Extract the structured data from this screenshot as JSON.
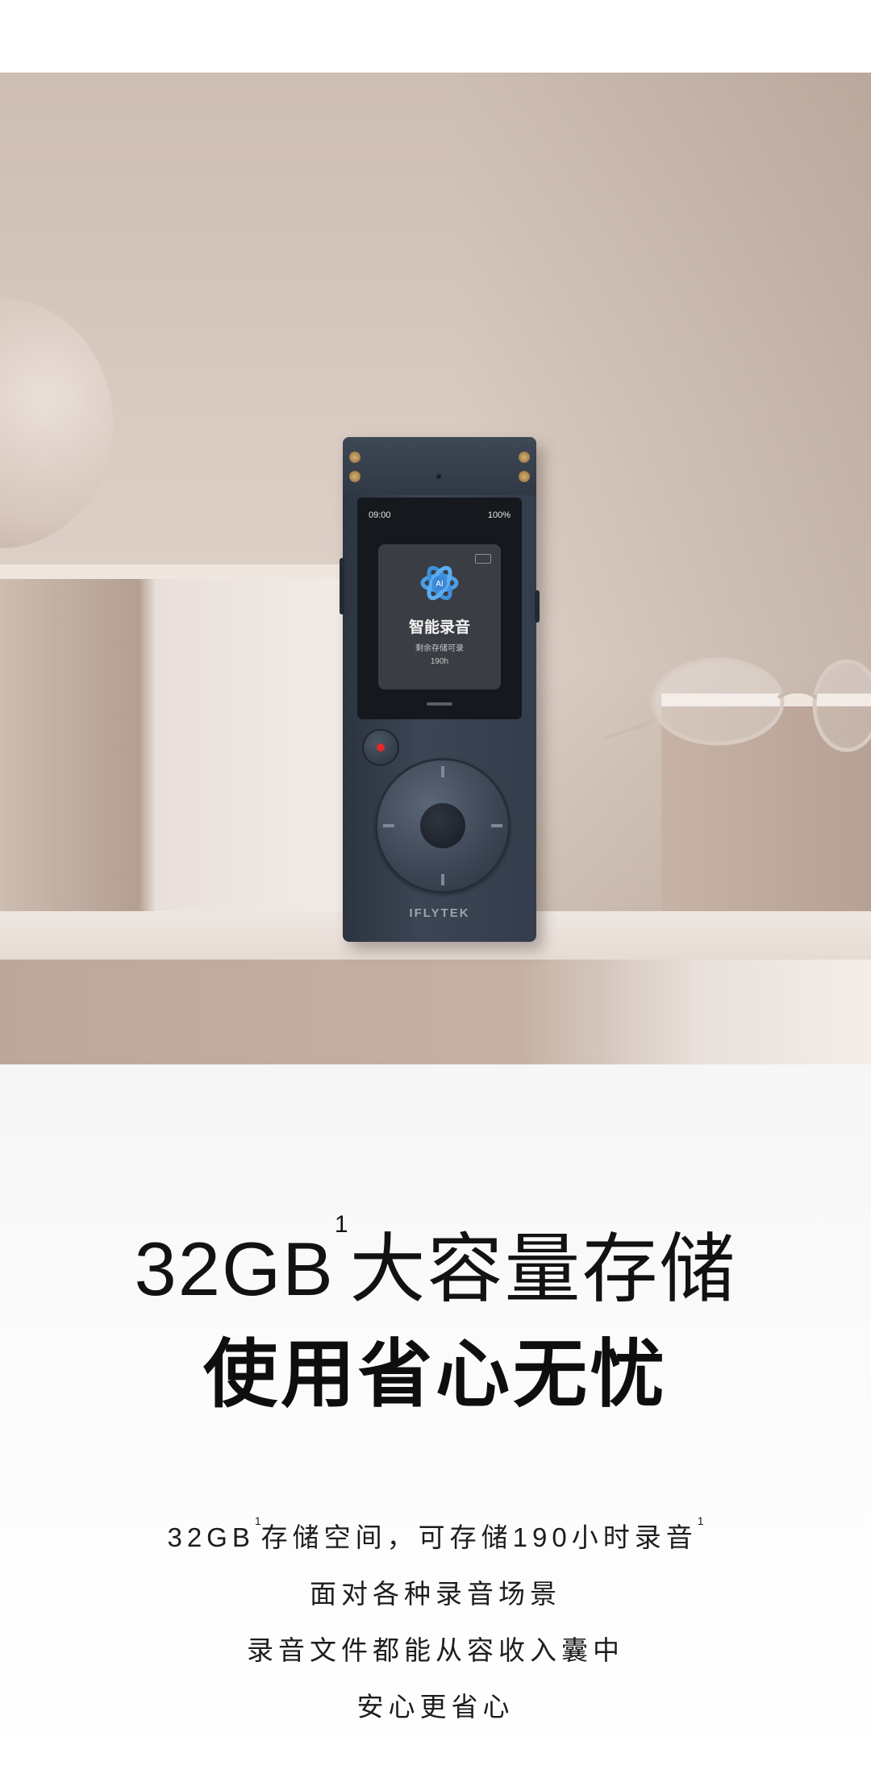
{
  "hero": {
    "device": {
      "status_time": "09:00",
      "status_battery": "100%",
      "card_title": "智能录音",
      "card_subtitle": "剩余存储可录",
      "card_hours": "190h",
      "brand": "IFLYTEK",
      "icons": [
        "ai-logo-icon",
        "storage-icon",
        "record-icon",
        "nav-wheel-icon"
      ]
    }
  },
  "headline": {
    "capacity": "32GB",
    "note_mark": "1",
    "title": "大容量存储",
    "subtitle": "使用省心无忧"
  },
  "body": {
    "line1_a": "32GB",
    "line1_mark": "1",
    "line1_b": "存储空间，可存储190小时录音",
    "line1_mark2": "1",
    "line2": "面对各种录音场景",
    "line3": "录音文件都能从容收入囊中",
    "line4": "安心更省心"
  }
}
